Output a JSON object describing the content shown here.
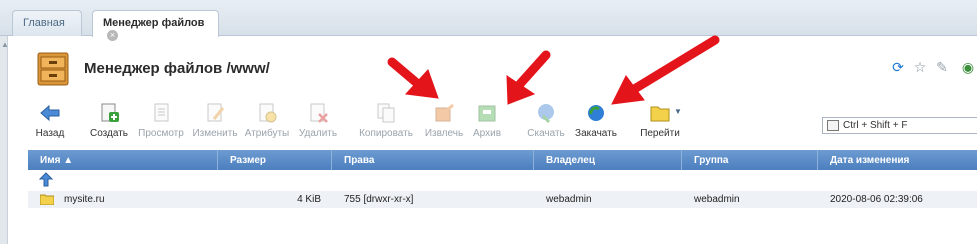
{
  "tabs": [
    {
      "label": "Главная"
    },
    {
      "label": "Менеджер файлов"
    }
  ],
  "page": {
    "title": "Менеджер файлов /www/"
  },
  "toolbar": {
    "back": "Назад",
    "create": "Создать",
    "view": "Просмотр",
    "edit": "Изменить",
    "attributes": "Атрибуты",
    "delete": "Удалить",
    "copy": "Копировать",
    "extract": "Извлечь",
    "archive": "Архив",
    "download": "Скачать",
    "upload": "Закачать",
    "goto": "Перейти"
  },
  "search": {
    "placeholder": "Ctrl + Shift + F"
  },
  "table": {
    "columns": [
      "Имя ▲",
      "Размер",
      "Права",
      "Владелец",
      "Группа",
      "Дата изменения"
    ],
    "rows": [
      {
        "name": "mysite.ru",
        "size": "4 KiB",
        "rights": "755 [drwxr-xr-x]",
        "owner": "webadmin",
        "group": "webadmin",
        "modified": "2020-08-06 02:39:06"
      }
    ]
  },
  "colors": {
    "header_bg": "#4c7fbf",
    "annotation_arrow": "#e4141b",
    "row_bg": "#eef2f6"
  }
}
